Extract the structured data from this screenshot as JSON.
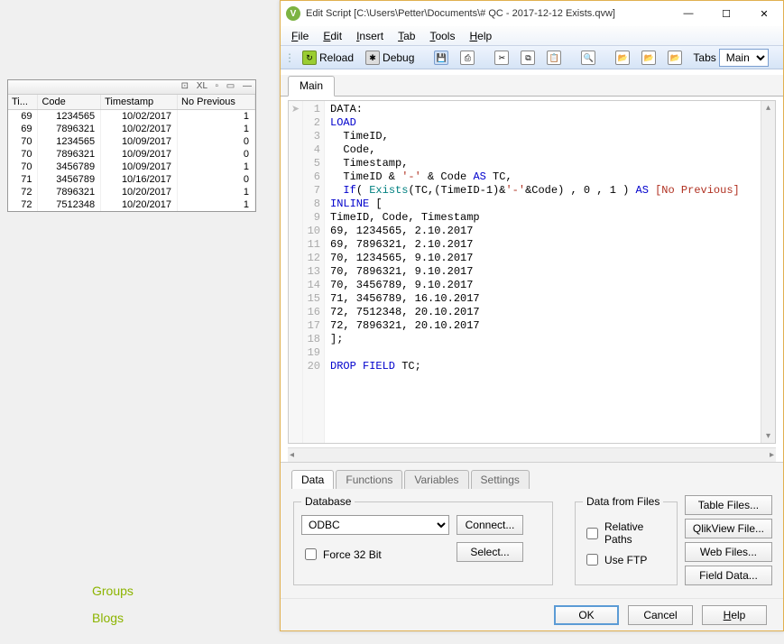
{
  "background_links": [
    "Groups",
    "Blogs"
  ],
  "table": {
    "titlebar_icons": [
      "⊡",
      "⊠",
      "XL",
      "▫",
      "▭",
      "—"
    ],
    "columns": [
      "Ti...",
      "Code",
      "Timestamp",
      "No Previous"
    ],
    "rows": [
      {
        "tid": "69",
        "code": "1234565",
        "ts": "10/02/2017",
        "np": "1"
      },
      {
        "tid": "69",
        "code": "7896321",
        "ts": "10/02/2017",
        "np": "1"
      },
      {
        "tid": "70",
        "code": "1234565",
        "ts": "10/09/2017",
        "np": "0"
      },
      {
        "tid": "70",
        "code": "7896321",
        "ts": "10/09/2017",
        "np": "0"
      },
      {
        "tid": "70",
        "code": "3456789",
        "ts": "10/09/2017",
        "np": "1"
      },
      {
        "tid": "71",
        "code": "3456789",
        "ts": "10/16/2017",
        "np": "0"
      },
      {
        "tid": "72",
        "code": "7896321",
        "ts": "10/20/2017",
        "np": "1"
      },
      {
        "tid": "72",
        "code": "7512348",
        "ts": "10/20/2017",
        "np": "1"
      }
    ]
  },
  "editor": {
    "title": "Edit Script [C:\\Users\\Petter\\Documents\\# QC - 2017-12-12 Exists.qvw]",
    "menus": [
      "File",
      "Edit",
      "Insert",
      "Tab",
      "Tools",
      "Help"
    ],
    "toolbar": {
      "reload": "Reload",
      "debug": "Debug",
      "tabs_label": "Tabs",
      "tabs_value": "Main"
    },
    "tab_main": "Main",
    "code_lines": [
      {
        "n": 1,
        "html": "DATA:"
      },
      {
        "n": 2,
        "html": "<span class='kw'>LOAD</span>"
      },
      {
        "n": 3,
        "html": "  TimeID,"
      },
      {
        "n": 4,
        "html": "  Code,"
      },
      {
        "n": 5,
        "html": "  Timestamp,"
      },
      {
        "n": 6,
        "html": "  TimeID &amp; <span class='str'>'-'</span> &amp; Code <span class='kw'>AS</span> TC,"
      },
      {
        "n": 7,
        "html": "  <span class='kw'>If</span>( <span class='func'>Exists</span>(TC,(TimeID-1)&amp;<span class='str'>'-'</span>&amp;Code) , 0 , 1 ) <span class='kw'>AS</span> <span class='id'>[No Previous]</span>"
      },
      {
        "n": 8,
        "html": "<span class='kw'>INLINE</span> ["
      },
      {
        "n": 9,
        "html": "TimeID, Code, Timestamp"
      },
      {
        "n": 10,
        "html": "69, 1234565, 2.10.2017"
      },
      {
        "n": 11,
        "html": "69, 7896321, 2.10.2017"
      },
      {
        "n": 12,
        "html": "70, 1234565, 9.10.2017"
      },
      {
        "n": 13,
        "html": "70, 7896321, 9.10.2017"
      },
      {
        "n": 14,
        "html": "70, 3456789, 9.10.2017"
      },
      {
        "n": 15,
        "html": "71, 3456789, 16.10.2017"
      },
      {
        "n": 16,
        "html": "72, 7512348, 20.10.2017"
      },
      {
        "n": 17,
        "html": "72, 7896321, 20.10.2017"
      },
      {
        "n": 18,
        "html": "];"
      },
      {
        "n": 19,
        "html": ""
      },
      {
        "n": 20,
        "html": "<span class='kw'>DROP FIELD</span> TC;"
      }
    ],
    "bottom_tabs": [
      "Data",
      "Functions",
      "Variables",
      "Settings"
    ],
    "db": {
      "legend": "Database",
      "select": "ODBC",
      "connect": "Connect...",
      "select_btn": "Select...",
      "force32": "Force 32 Bit"
    },
    "files": {
      "legend": "Data from Files",
      "relpath": "Relative Paths",
      "useftp": "Use FTP",
      "buttons": [
        "Table Files...",
        "QlikView File...",
        "Web Files...",
        "Field Data..."
      ]
    },
    "footer": {
      "ok": "OK",
      "cancel": "Cancel",
      "help": "Help"
    }
  }
}
